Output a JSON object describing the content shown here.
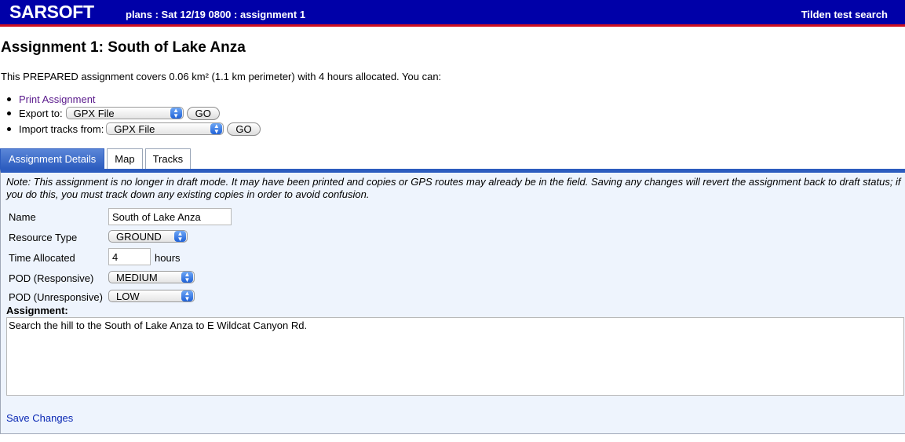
{
  "header": {
    "brand": "SARSOFT",
    "breadcrumb": "plans  : Sat 12/19 0800 : assignment 1",
    "search_name": "Tilden test search"
  },
  "page": {
    "title": "Assignment 1: South of Lake Anza",
    "summary": "This PREPARED assignment covers 0.06 km² (1.1 km perimeter) with 4 hours allocated. You can:"
  },
  "actions": {
    "print_label": "Print Assignment",
    "export_label": "Export to:",
    "export_value": "GPX File",
    "export_go": "GO",
    "import_label": "Import tracks from:",
    "import_value": "GPX File",
    "import_go": "GO"
  },
  "tabs": [
    {
      "label": "Assignment Details",
      "active": true
    },
    {
      "label": "Map",
      "active": false
    },
    {
      "label": "Tracks",
      "active": false
    }
  ],
  "form": {
    "note": "Note: This assignment is no longer in draft mode.  It may have been printed and copies or GPS routes may already be in the field.  Saving any changes will revert the assignment back to draft status; if you do this, you must track down any existing copies in order to avoid confusion.",
    "name_label": "Name",
    "name_value": "South of Lake Anza",
    "resource_label": "Resource Type",
    "resource_value": "GROUND",
    "time_label": "Time Allocated",
    "time_value": "4",
    "time_unit": "hours",
    "pod_resp_label": "POD (Responsive)",
    "pod_resp_value": "MEDIUM",
    "pod_unresp_label": "POD (Unresponsive)",
    "pod_unresp_value": "LOW",
    "assignment_label": "Assignment:",
    "assignment_text": "Search the hill to the South of Lake Anza to E Wildcat Canyon Rd.",
    "save_label": "Save Changes"
  },
  "colors": {
    "header_bg": "#0000a8",
    "header_rule": "#d01020",
    "tab_active": "#2c5cbf",
    "panel_bg": "#eef4fd"
  }
}
